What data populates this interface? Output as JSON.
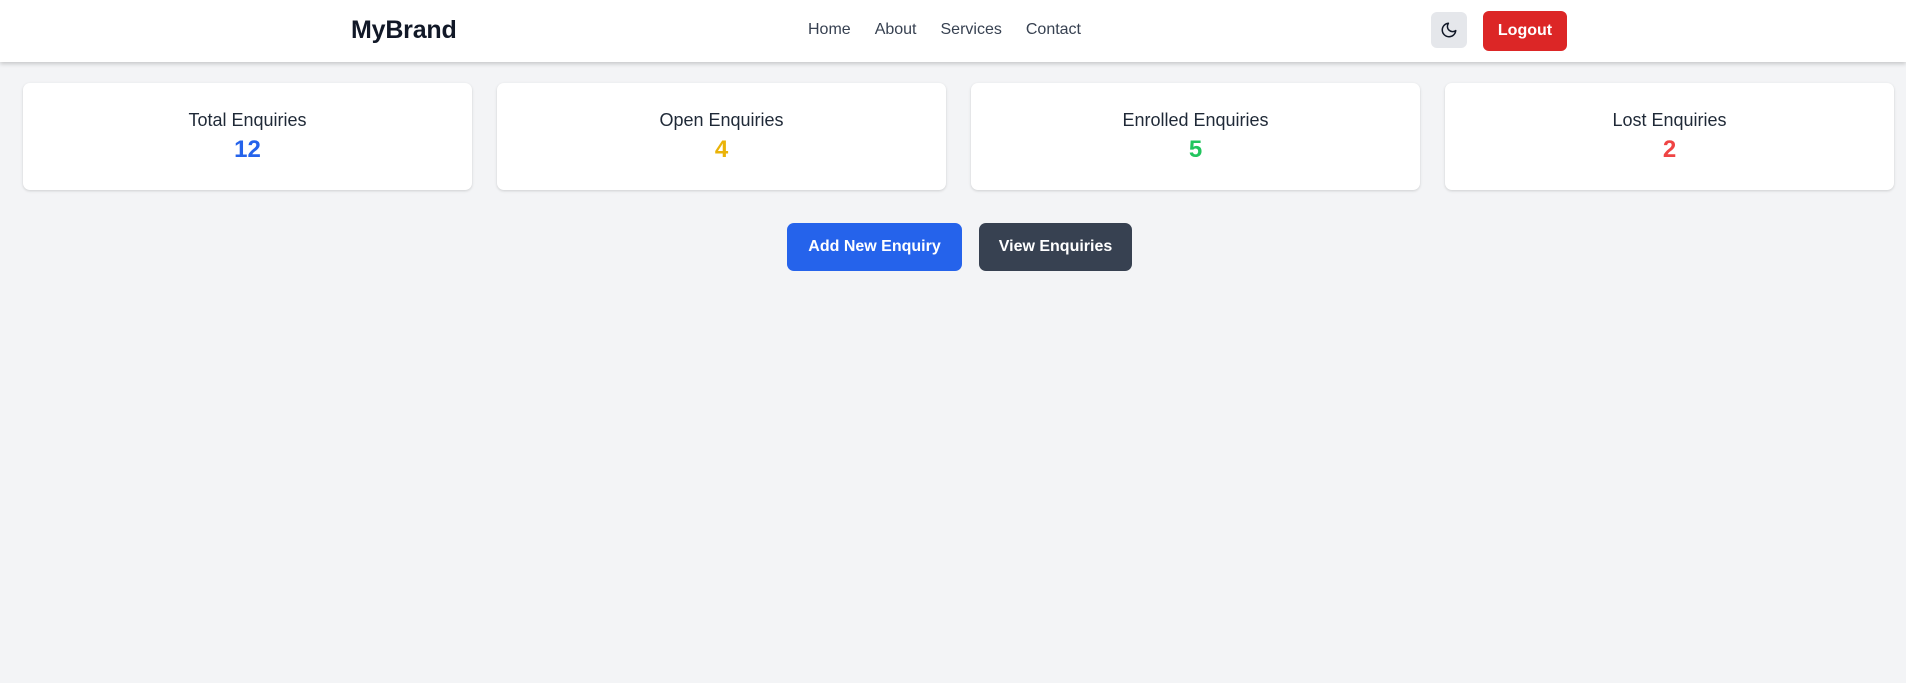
{
  "navbar": {
    "brand": "MyBrand",
    "links": [
      {
        "label": "Home"
      },
      {
        "label": "About"
      },
      {
        "label": "Services"
      },
      {
        "label": "Contact"
      }
    ],
    "theme_toggle_icon": "moon-icon",
    "logout_label": "Logout"
  },
  "stats": [
    {
      "label": "Total Enquiries",
      "value": "12",
      "color": "#2563eb"
    },
    {
      "label": "Open Enquiries",
      "value": "4",
      "color": "#eab308"
    },
    {
      "label": "Enrolled Enquiries",
      "value": "5",
      "color": "#22c55e"
    },
    {
      "label": "Lost Enquiries",
      "value": "2",
      "color": "#ef4444"
    }
  ],
  "actions": {
    "add_label": "Add New Enquiry",
    "add_color": "#2563eb",
    "view_label": "View Enquiries",
    "view_color": "#374151"
  },
  "colors": {
    "background": "#f3f4f6",
    "logout": "#dc2626"
  }
}
